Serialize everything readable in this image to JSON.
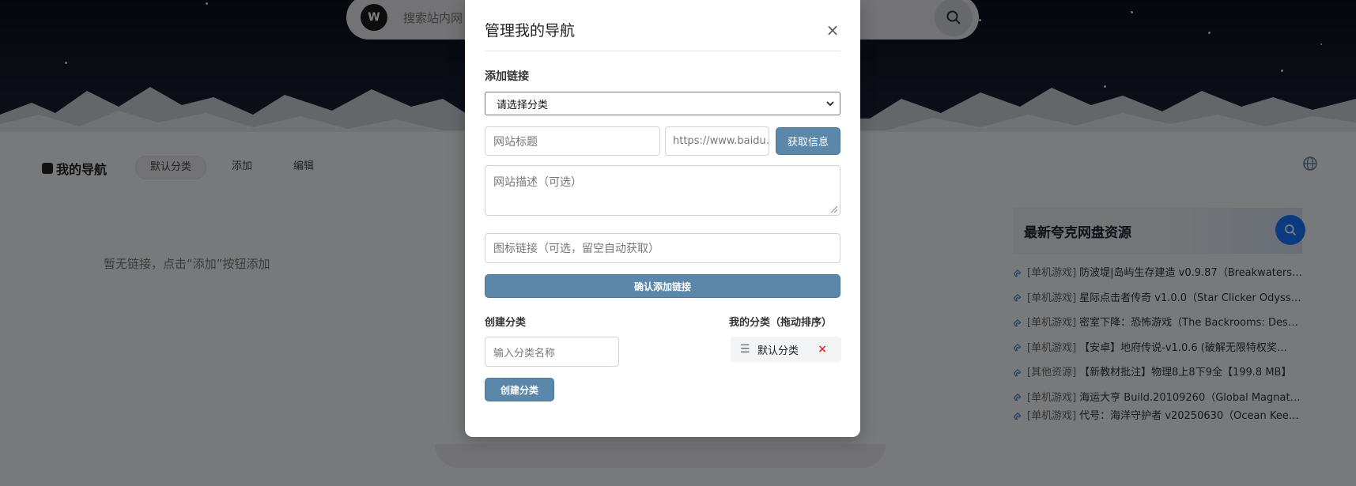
{
  "header": {
    "search_placeholder": "搜索站内网",
    "logo_text": "W"
  },
  "nav": {
    "brand": "我的导航",
    "tabs": [
      {
        "label": "默认分类",
        "active": true
      },
      {
        "label": "添加",
        "active": false
      },
      {
        "label": "编辑",
        "active": false
      }
    ]
  },
  "main": {
    "empty_message": "暂无链接，点击“添加”按钮添加"
  },
  "sidebar": {
    "title": "最新夸克网盘资源",
    "items": [
      {
        "tag": "[单机游戏]",
        "text": "防波堤|岛屿生存建造 v0.9.87（Breakwaters…"
      },
      {
        "tag": "[单机游戏]",
        "text": "星际点击者传奇 v1.0.0（Star Clicker Odysse…"
      },
      {
        "tag": "[单机游戏]",
        "text": "密室下降：恐怖游戏（The Backrooms: Des…"
      },
      {
        "tag": "[单机游戏]",
        "text": "【安卓】地府传说-v1.0.6 (破解无限特权奖…"
      },
      {
        "tag": "[其他资源]",
        "text": "【新教材批注】物理8上8下9全【199.8 MB】"
      },
      {
        "tag": "[单机游戏]",
        "text": "海运大亨 Build.20109260（Global Magnate…"
      },
      {
        "tag": "[单机游戏]",
        "text": "代号：海洋守护者 v20250630（Ocean Kee…"
      }
    ]
  },
  "modal": {
    "title": "管理我的导航",
    "close_label": "×",
    "add_link_label": "添加链接",
    "category_select": "请选择分类",
    "site_title_placeholder": "网站标题",
    "url_placeholder": "https://www.baidu.c",
    "fetch_button": "获取信息",
    "desc_placeholder": "网站描述（可选）",
    "icon_placeholder": "图标链接（可选，留空自动获取）",
    "confirm_button": "确认添加链接",
    "create_category_label": "创建分类",
    "category_name_placeholder": "输入分类名称",
    "create_category_button": "创建分类",
    "my_categories_label": "我的分类（拖动排序）",
    "categories": [
      {
        "name": "默认分类",
        "remove": "×"
      }
    ]
  },
  "colors": {
    "accent_button": "#5b87ab",
    "remove_red": "#d9302c",
    "sidebar_search": "#1677ff"
  }
}
